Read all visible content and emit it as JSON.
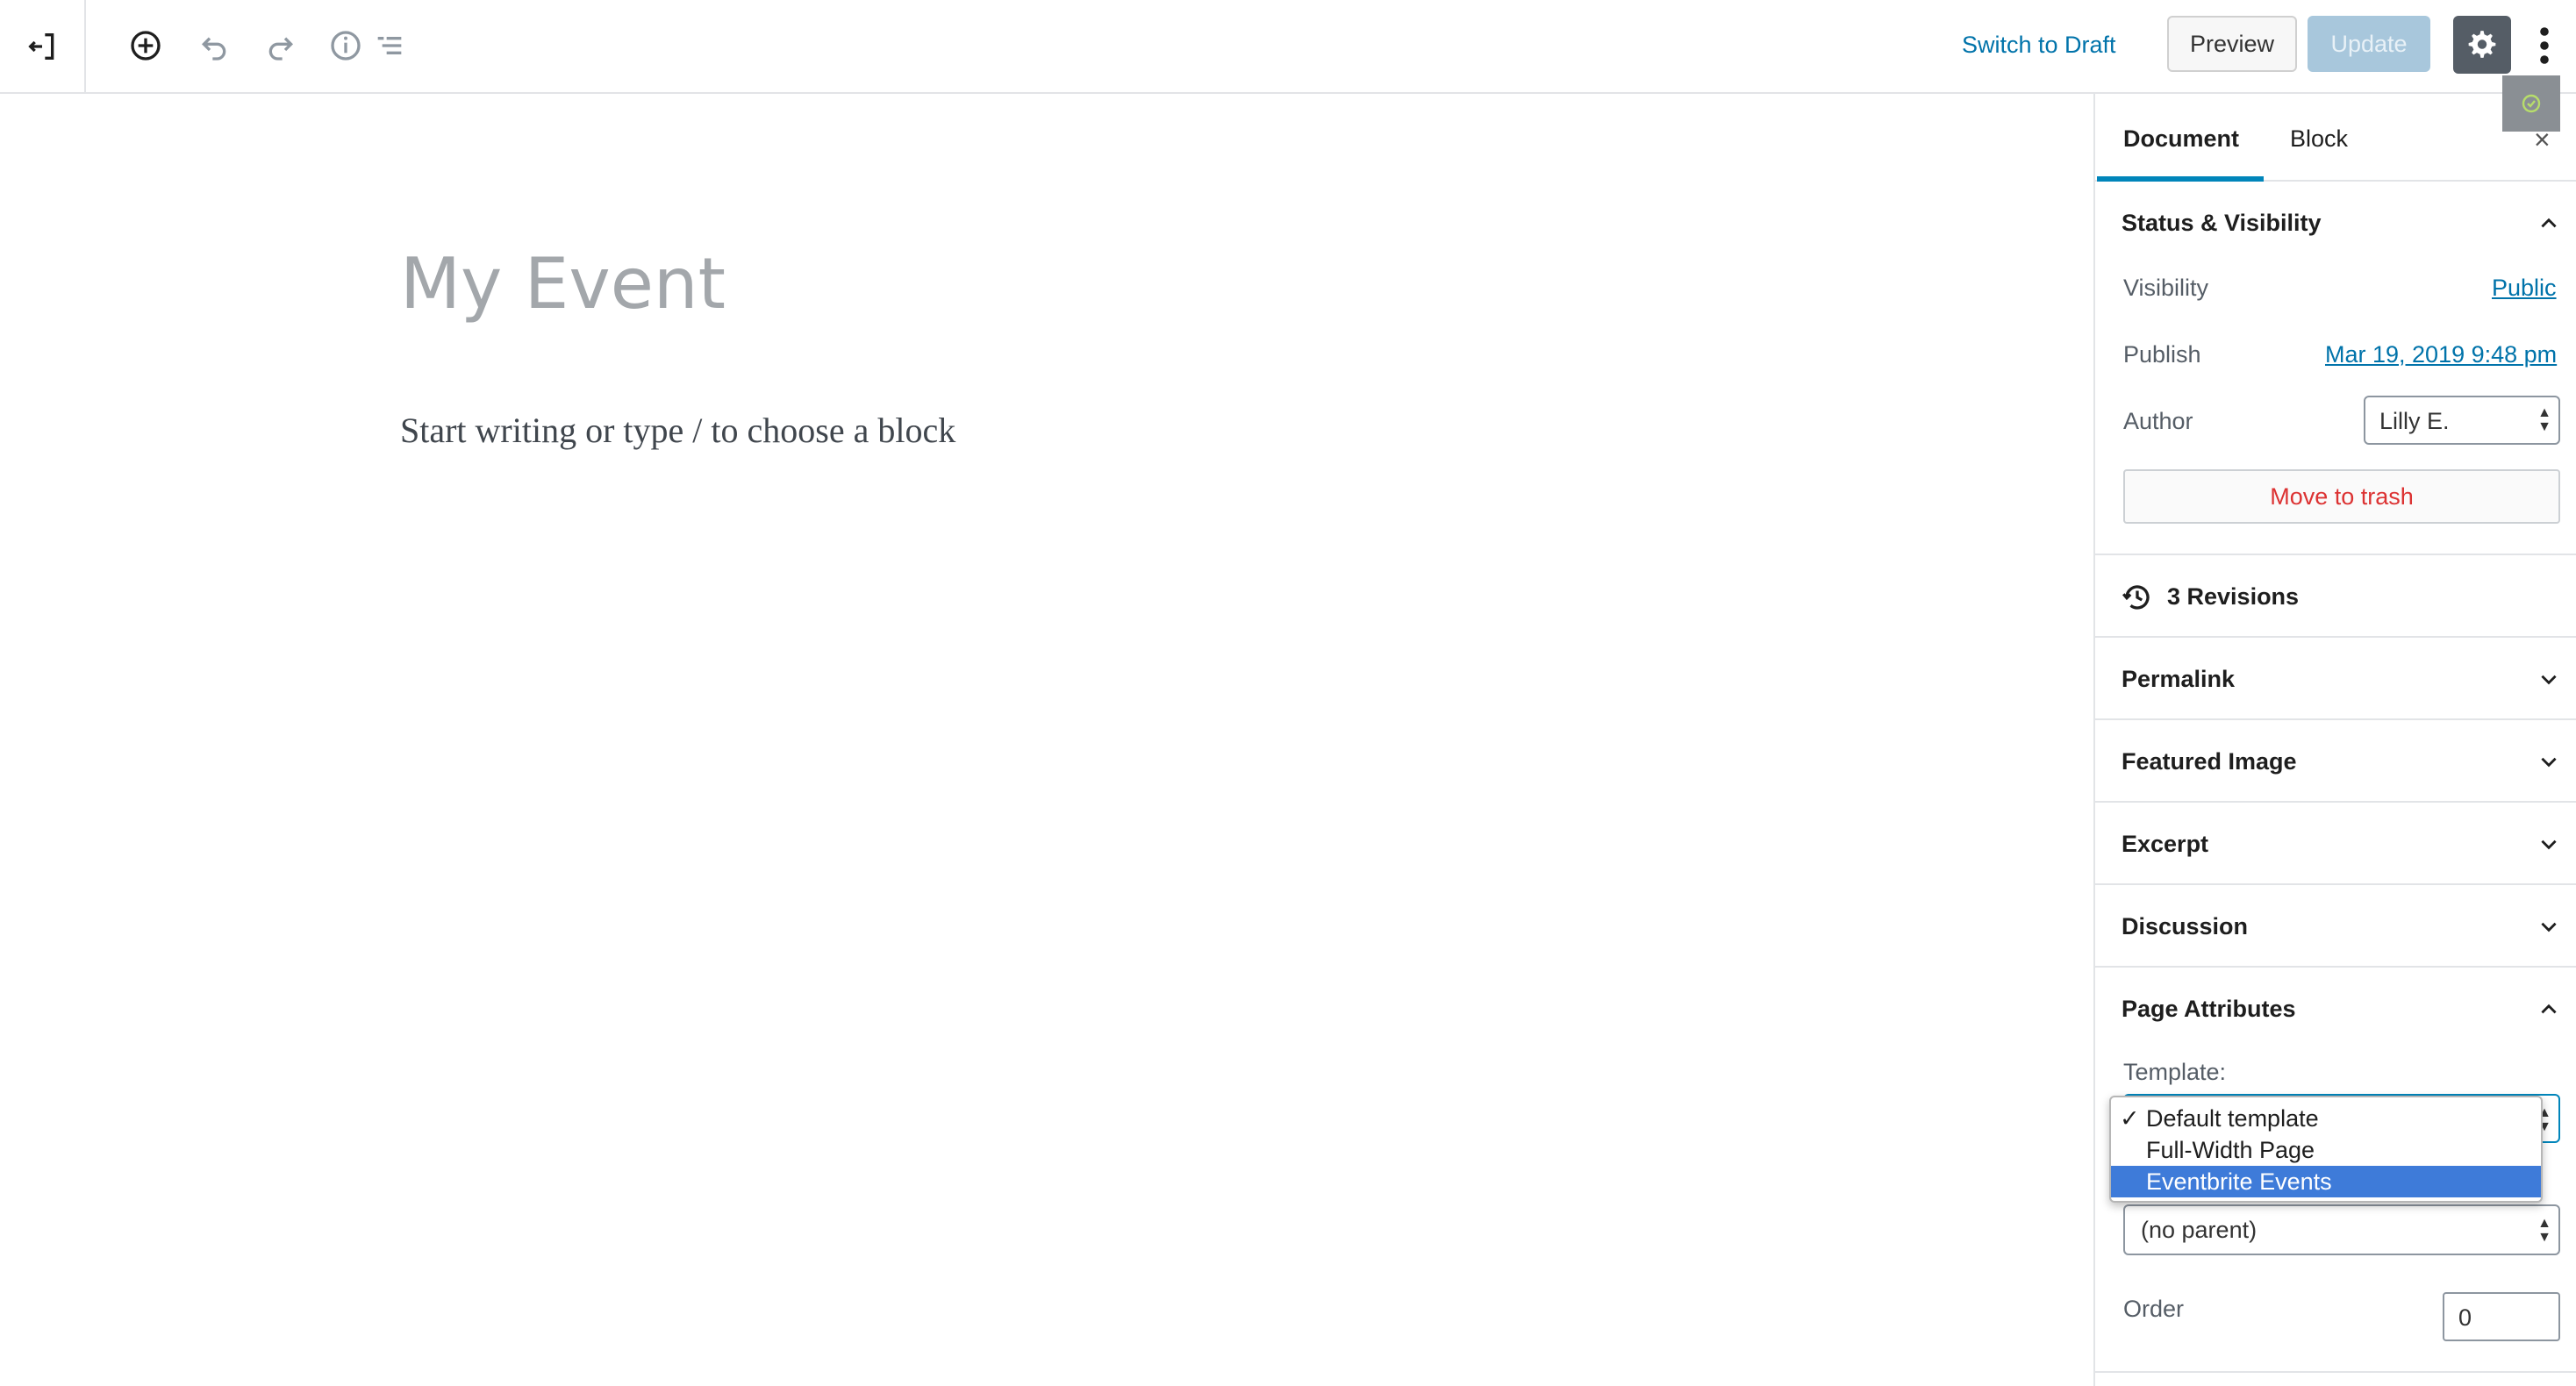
{
  "toolbar": {
    "switch_to_draft": "Switch to Draft",
    "preview": "Preview",
    "update": "Update"
  },
  "editor": {
    "title": "My Event",
    "placeholder": "Start writing or type / to choose a block"
  },
  "sidebar": {
    "tabs": [
      "Document",
      "Block"
    ],
    "close": "×",
    "status": {
      "title": "Status & Visibility",
      "visibility_label": "Visibility",
      "visibility_value": "Public",
      "publish_label": "Publish",
      "publish_value": "Mar 19, 2019 9:48 pm",
      "author_label": "Author",
      "author_value": "Lilly E.",
      "trash": "Move to trash"
    },
    "revisions": "3 Revisions",
    "panels": [
      "Permalink",
      "Featured Image",
      "Excerpt",
      "Discussion"
    ],
    "page_attributes": {
      "title": "Page Attributes",
      "template_label": "Template:",
      "template_options": [
        "Default template",
        "Full-Width Page",
        "Eventbrite Events"
      ],
      "parent_value": "(no parent)",
      "order_label": "Order",
      "order_value": "0"
    }
  },
  "colors": {
    "accent": "#0085ba",
    "link": "#0073aa",
    "danger": "#dc3232",
    "highlight": "#3e7bd9"
  }
}
